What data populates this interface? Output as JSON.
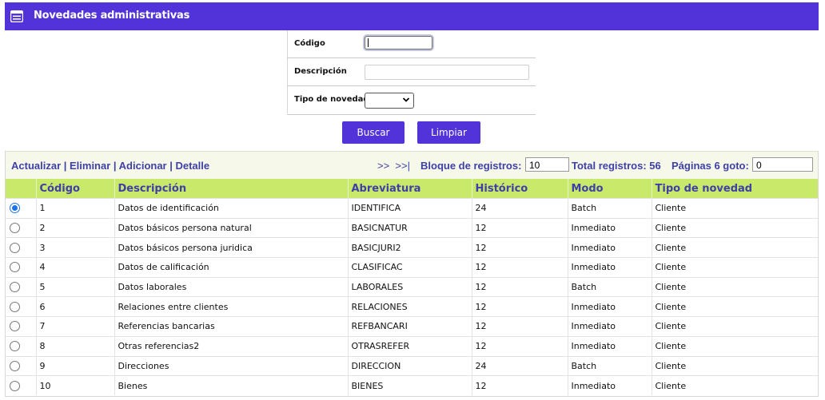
{
  "header": {
    "title": "Novedades administrativas",
    "icon": "window-list-icon"
  },
  "form": {
    "codigo_label": "Código",
    "codigo_value": "",
    "descripcion_label": "Descripción",
    "descripcion_value": "",
    "tipo_label": "Tipo de novedad",
    "tipo_value": ""
  },
  "buttons": {
    "buscar": "Buscar",
    "limpiar": "Limpiar"
  },
  "toolbar": {
    "actions": "Actualizar | Eliminar | Adicionar | Detalle",
    "nav": ">>  >>|",
    "bloque_label": "Bloque de registros:",
    "bloque_value": "10",
    "total_label": "Total registros: 56",
    "paginas_label": "Páginas 6 goto:",
    "goto_value": "0"
  },
  "table": {
    "columns": [
      "",
      "Código",
      "Descripción",
      "Abreviatura",
      "Histórico",
      "Modo",
      "Tipo de novedad"
    ],
    "selected_index": 0,
    "rows": [
      [
        "1",
        "Datos de identificación",
        "IDENTIFICA",
        "24",
        "Batch",
        "Cliente"
      ],
      [
        "2",
        "Datos básicos persona natural",
        "BASICNATUR",
        "12",
        "Inmediato",
        "Cliente"
      ],
      [
        "3",
        "Datos básicos persona juridica",
        "BASICJURI2",
        "12",
        "Inmediato",
        "Cliente"
      ],
      [
        "4",
        "Datos de calificación",
        "CLASIFICAC",
        "12",
        "Inmediato",
        "Cliente"
      ],
      [
        "5",
        "Datos laborales",
        "LABORALES",
        "12",
        "Batch",
        "Cliente"
      ],
      [
        "6",
        "Relaciones entre clientes",
        "RELACIONES",
        "12",
        "Inmediato",
        "Cliente"
      ],
      [
        "7",
        "Referencias bancarias",
        "REFBANCARI",
        "12",
        "Inmediato",
        "Cliente"
      ],
      [
        "8",
        "Otras referencias2",
        "OTRASREFER",
        "12",
        "Inmediato",
        "Cliente"
      ],
      [
        "9",
        "Direcciones",
        "DIRECCION",
        "24",
        "Batch",
        "Cliente"
      ],
      [
        "10",
        "Bienes",
        "BIENES",
        "12",
        "Inmediato",
        "Cliente"
      ]
    ]
  },
  "colors": {
    "primary": "#5133d9",
    "header_row": "#c9e96b",
    "link": "#3f3fa8",
    "toolbar_bg": "#f6f9ea"
  }
}
